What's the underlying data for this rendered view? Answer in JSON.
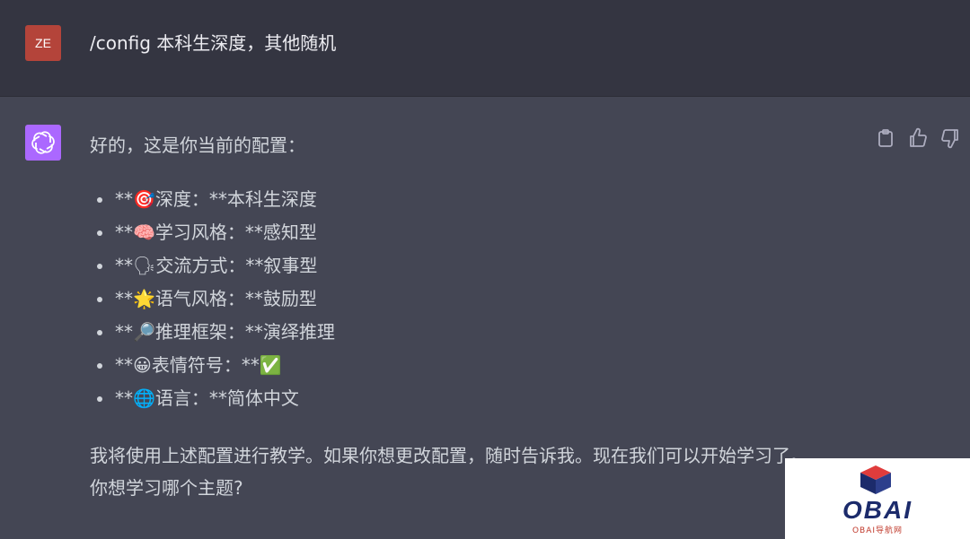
{
  "user_message": {
    "avatar_initials": "ZE",
    "text": "/config 本科生深度，其他随机"
  },
  "assistant_message": {
    "intro": "好的，这是你当前的配置：",
    "config_items": [
      "**🎯深度：**本科生深度",
      "**🧠学习风格：**感知型",
      "**🗣交流方式：**叙事型",
      "**🌟语气风格：**鼓励型",
      "**🔎推理框架：**演绎推理",
      "**😀表情符号：**✅",
      "**🌐语言：**简体中文"
    ],
    "closing_line1": "我将使用上述配置进行教学。如果你想更改配置，随时告诉我。现在我们可以开始学习了。",
    "closing_line2": "你想学习哪个主题?"
  },
  "actions": {
    "icons": [
      "clipboard-icon",
      "thumbs-up-icon",
      "thumbs-down-icon"
    ]
  },
  "watermark": {
    "brand": "OBAI",
    "subtitle": "OBAI导航网"
  },
  "colors": {
    "user_bg": "#343541",
    "assistant_bg": "#444654",
    "user_avatar": "#b4443a",
    "bot_avatar": "#ab68ff"
  }
}
